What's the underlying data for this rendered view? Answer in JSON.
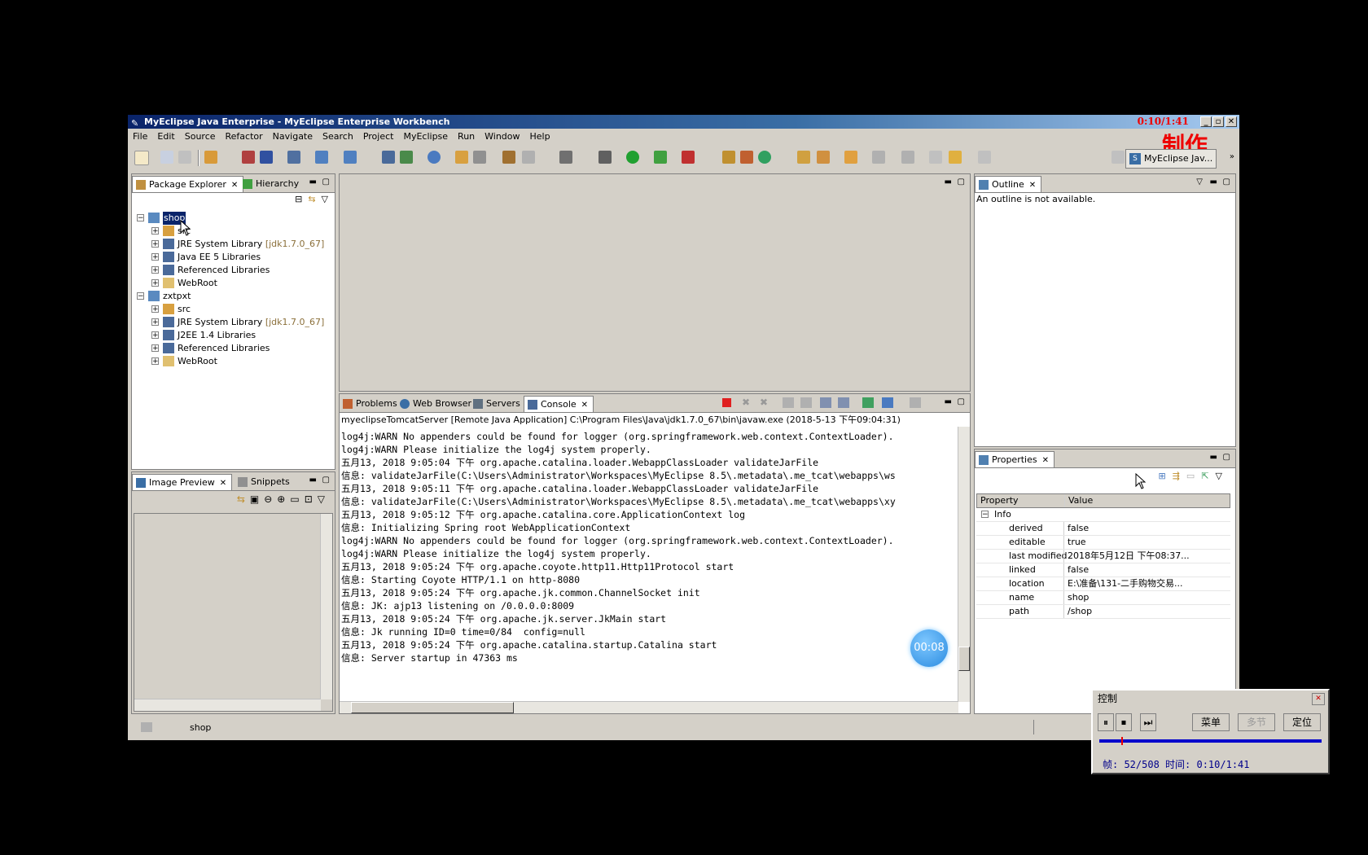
{
  "window": {
    "title": "MyEclipse Java Enterprise - MyEclipse Enterprise Workbench",
    "timer_overlay": "0:10/1:41"
  },
  "brand_overlay": "制作",
  "menu": [
    "File",
    "Edit",
    "Source",
    "Refactor",
    "Navigate",
    "Search",
    "Project",
    "MyEclipse",
    "Run",
    "Window",
    "Help"
  ],
  "perspective": {
    "label": "MyEclipse Jav..."
  },
  "package_explorer": {
    "tabs": [
      "Package Explorer",
      "Hierarchy"
    ],
    "tree": [
      {
        "label": "shop",
        "suffix": "",
        "level": 0,
        "expanded": true,
        "selected": true
      },
      {
        "label": "src",
        "suffix": "",
        "level": 1
      },
      {
        "label": "JRE System Library",
        "suffix": "[jdk1.7.0_67]",
        "level": 1
      },
      {
        "label": "Java EE 5 Libraries",
        "suffix": "",
        "level": 1
      },
      {
        "label": "Referenced Libraries",
        "suffix": "",
        "level": 1
      },
      {
        "label": "WebRoot",
        "suffix": "",
        "level": 1
      },
      {
        "label": "zxtpxt",
        "suffix": "",
        "level": 0,
        "expanded": true
      },
      {
        "label": "src",
        "suffix": "",
        "level": 1
      },
      {
        "label": "JRE System Library",
        "suffix": "[jdk1.7.0_67]",
        "level": 1
      },
      {
        "label": "J2EE 1.4 Libraries",
        "suffix": "",
        "level": 1
      },
      {
        "label": "Referenced Libraries",
        "suffix": "",
        "level": 1
      },
      {
        "label": "WebRoot",
        "suffix": "",
        "level": 1
      }
    ]
  },
  "image_preview": {
    "tabs": [
      "Image Preview",
      "Snippets"
    ]
  },
  "console": {
    "tabs": [
      "Problems",
      "Web Browser",
      "Servers",
      "Console"
    ],
    "header": "myeclipseTomcatServer [Remote Java Application] C:\\Program Files\\Java\\jdk1.7.0_67\\bin\\javaw.exe (2018-5-13 下午09:04:31)",
    "lines": [
      "log4j:WARN No appenders could be found for logger (org.springframework.web.context.ContextLoader).",
      "log4j:WARN Please initialize the log4j system properly.",
      "五月13, 2018 9:05:04 下午 org.apache.catalina.loader.WebappClassLoader validateJarFile",
      "信息: validateJarFile(C:\\Users\\Administrator\\Workspaces\\MyEclipse 8.5\\.metadata\\.me_tcat\\webapps\\ws",
      "五月13, 2018 9:05:11 下午 org.apache.catalina.loader.WebappClassLoader validateJarFile",
      "信息: validateJarFile(C:\\Users\\Administrator\\Workspaces\\MyEclipse 8.5\\.metadata\\.me_tcat\\webapps\\xy",
      "五月13, 2018 9:05:12 下午 org.apache.catalina.core.ApplicationContext log",
      "信息: Initializing Spring root WebApplicationContext",
      "log4j:WARN No appenders could be found for logger (org.springframework.web.context.ContextLoader).",
      "log4j:WARN Please initialize the log4j system properly.",
      "五月13, 2018 9:05:24 下午 org.apache.coyote.http11.Http11Protocol start",
      "信息: Starting Coyote HTTP/1.1 on http-8080",
      "五月13, 2018 9:05:24 下午 org.apache.jk.common.ChannelSocket init",
      "信息: JK: ajp13 listening on /0.0.0.0:8009",
      "五月13, 2018 9:05:24 下午 org.apache.jk.server.JkMain start",
      "信息: Jk running ID=0 time=0/84  config=null",
      "五月13, 2018 9:05:24 下午 org.apache.catalina.startup.Catalina start",
      "信息: Server startup in 47363 ms"
    ]
  },
  "outline": {
    "tab": "Outline",
    "message": "An outline is not available."
  },
  "properties": {
    "tab": "Properties",
    "columns": [
      "Property",
      "Value"
    ],
    "group": "Info",
    "rows": [
      {
        "k": "derived",
        "v": "false"
      },
      {
        "k": "editable",
        "v": "true"
      },
      {
        "k": "last modified",
        "v": "2018年5月12日 下午08:37..."
      },
      {
        "k": "linked",
        "v": "false"
      },
      {
        "k": "location",
        "v": "E:\\准备\\131-二手购物交易..."
      },
      {
        "k": "name",
        "v": "shop"
      },
      {
        "k": "path",
        "v": "/shop"
      }
    ]
  },
  "status": {
    "text": "shop"
  },
  "bubble": "00:08",
  "control": {
    "title": "控制",
    "buttons": [
      "菜单",
      "多节",
      "定位"
    ],
    "info": "帧: 52/508 时间: 0:10/1:41",
    "progress": 0.1
  }
}
